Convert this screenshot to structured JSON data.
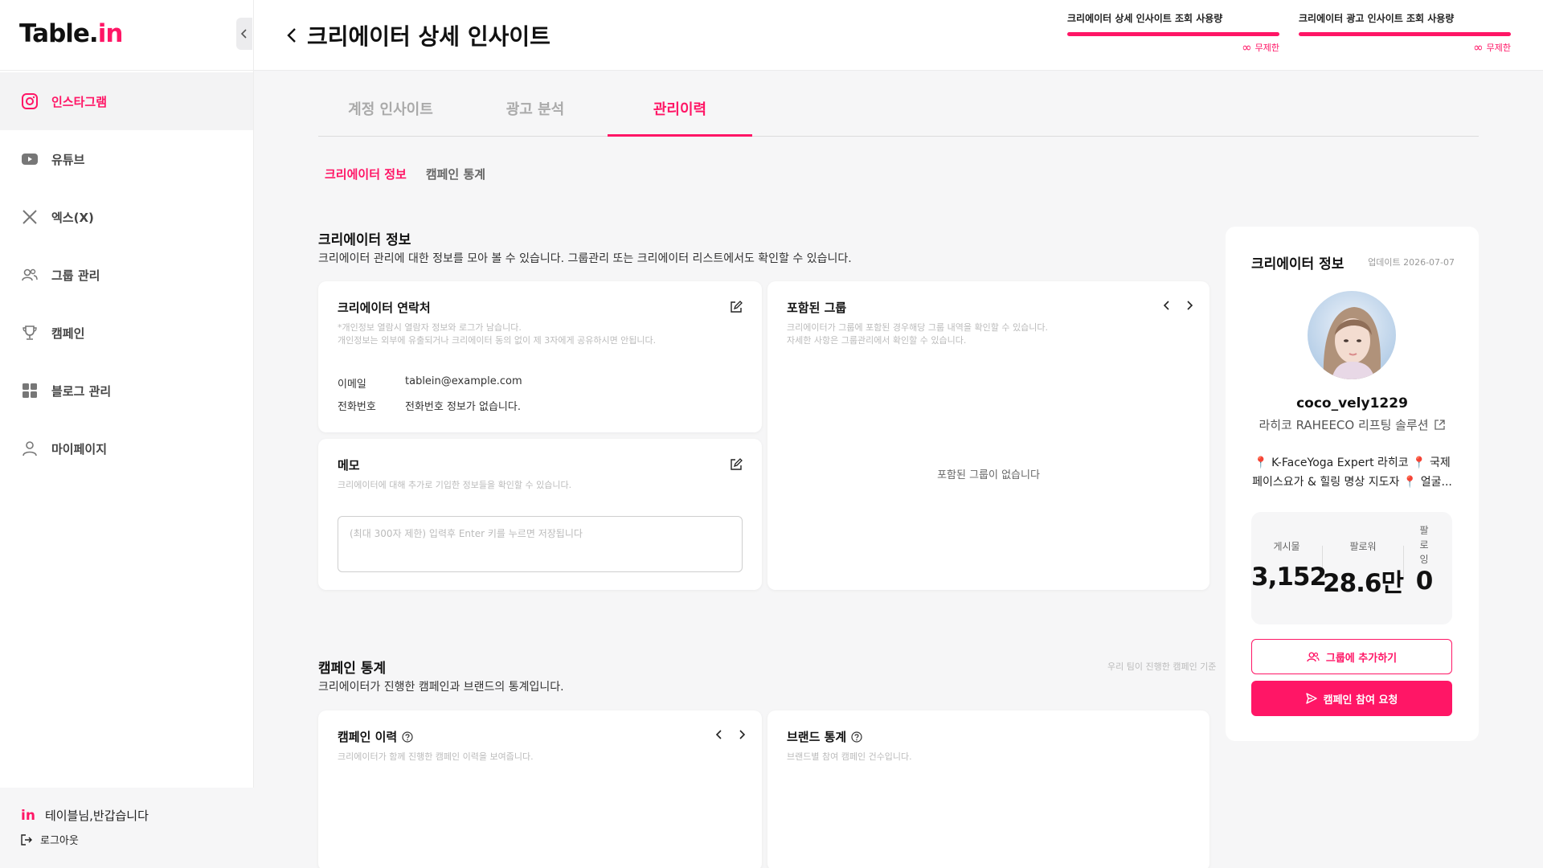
{
  "sidebar": {
    "logo_main": "Table.",
    "logo_accent": "in",
    "items": [
      {
        "label": "인스타그램",
        "icon": "instagram-icon"
      },
      {
        "label": "유튜브",
        "icon": "youtube-icon"
      },
      {
        "label": "엑스(X)",
        "icon": "x-icon"
      },
      {
        "label": "그룹 관리",
        "icon": "group-icon"
      },
      {
        "label": "캠페인",
        "icon": "trophy-icon"
      },
      {
        "label": "블로그 관리",
        "icon": "grid-icon"
      },
      {
        "label": "마이페이지",
        "icon": "user-icon"
      }
    ],
    "footer_mark": "in",
    "greeting": "테이블님,반갑습니다",
    "logout": "로그아웃"
  },
  "header": {
    "title": "크리에이터 상세 인사이트",
    "usage": [
      {
        "label": "크리에이터 상세 인사이트 조회 사용량",
        "value": "무제한"
      },
      {
        "label": "크리에이터 광고 인사이트 조회 사용량",
        "value": "무제한"
      }
    ]
  },
  "tabs": [
    "계정 인사이트",
    "광고 분석",
    "관리이력"
  ],
  "subtabs": [
    "크리에이터 정보",
    "캠페인 통계"
  ],
  "creator_info": {
    "title": "크리에이터 정보",
    "desc": "크리에이터 관리에 대한 정보를 모아 볼 수 있습니다. 그룹관리 또는 크리에이터 리스트에서도 확인할 수 있습니다.",
    "contact": {
      "title": "크리에이터 연락처",
      "hint1": "*개인정보 열람시 열람자 정보와 로그가 남습니다.",
      "hint2": "개인정보는 외부에 유출되거나 크리에이터 동의 없이 제 3자에게 공유하시면 안됩니다.",
      "email_label": "이메일",
      "email_value": "tablein@example.com",
      "phone_label": "전화번호",
      "phone_value": "전화번호 정보가 없습니다."
    },
    "memo": {
      "title": "메모",
      "hint": "크리에이터에 대해 추가로 기입한 정보들을 확인할 수 있습니다.",
      "placeholder": "(최대 300자 제한) 입력후 Enter 키를 누르면 저장됩니다"
    },
    "groups": {
      "title": "포함된 그룹",
      "hint1": "크리에이터가 그룹에 포함된 경우해당 그룹 내역을 확인할 수 있습니다.",
      "hint2": "자세한 사항은 그룹관리에서 확인할 수 있습니다.",
      "empty": "포함된 그룹이 없습니다"
    }
  },
  "campaign_stats": {
    "title": "캠페인 통계",
    "desc": "크리에이터가 진행한 캠페인과 브랜드의 통계입니다.",
    "criteria": "우리 팀이 진행한 캠페인 기준",
    "history": {
      "title": "캠페인 이력",
      "hint": "크리에이터가 함께 진행한 캠페인 이력을 보여줍니다."
    },
    "brand": {
      "title": "브랜드 통계",
      "hint": "브랜드별 참여 캠페인 건수입니다."
    }
  },
  "profile": {
    "title": "크리에이터 정보",
    "updated": "업데이트 2026-07-07",
    "handle": "coco_vely1229",
    "brand": "라히코 RAHEECO 리프팅 솔루션",
    "bio_line1": "📍 K-FaceYoga Expert 라히코 📍 국제",
    "bio_line2": "페이스요가 & 힐링 명상 지도자 📍 얼굴...",
    "stats": [
      {
        "label": "게시물",
        "value": "3,152"
      },
      {
        "label": "팔로워",
        "value": "28.6만"
      },
      {
        "label": "팔로잉",
        "value": "0"
      }
    ],
    "add_group": "그룹에 추가하기",
    "request": "캠페인 참여 요청"
  },
  "colors": {
    "accent": "#ff1666"
  }
}
